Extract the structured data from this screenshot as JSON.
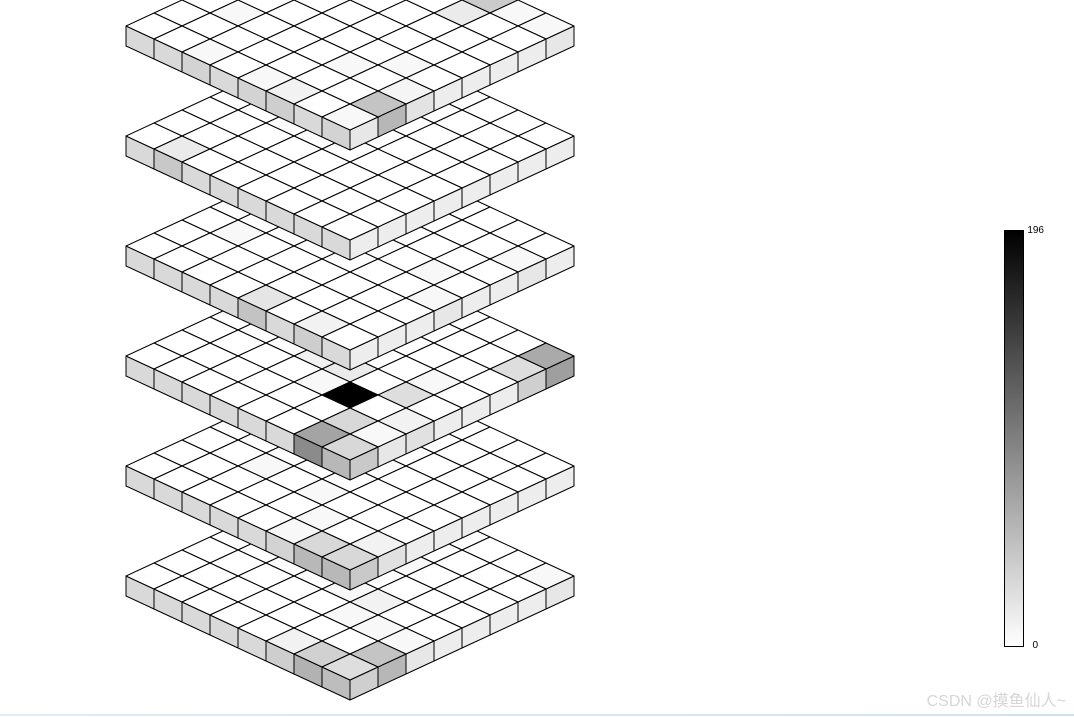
{
  "chart_data": {
    "type": "heatmap",
    "title": "",
    "xlabel": "",
    "ylabel": "",
    "description": "3D voxel grid, 6 stacked layers of 8x8 cubes, grayscale colormap",
    "grid": {
      "nx": 8,
      "ny": 8,
      "nz": 6
    },
    "colormap": {
      "name": "gray_r",
      "min": 0,
      "max": 196
    },
    "layers": [
      {
        "z": 5,
        "values": [
          [
            5,
            45,
            8,
            0,
            0,
            0,
            0,
            5
          ],
          [
            0,
            0,
            0,
            5,
            0,
            0,
            0,
            5
          ],
          [
            10,
            0,
            5,
            0,
            0,
            0,
            15,
            40
          ],
          [
            5,
            0,
            0,
            0,
            0,
            0,
            0,
            0
          ],
          [
            0,
            0,
            0,
            0,
            0,
            0,
            0,
            0
          ],
          [
            5,
            0,
            0,
            0,
            0,
            0,
            0,
            0
          ],
          [
            0,
            0,
            5,
            0,
            0,
            0,
            0,
            0
          ],
          [
            0,
            0,
            0,
            0,
            0,
            0,
            0,
            0
          ]
        ]
      },
      {
        "z": 4,
        "values": [
          [
            0,
            0,
            0,
            0,
            0,
            0,
            0,
            0
          ],
          [
            0,
            0,
            0,
            0,
            0,
            0,
            0,
            0
          ],
          [
            0,
            0,
            0,
            0,
            0,
            0,
            0,
            0
          ],
          [
            0,
            0,
            0,
            0,
            0,
            0,
            0,
            0
          ],
          [
            0,
            0,
            0,
            0,
            0,
            5,
            0,
            0
          ],
          [
            0,
            0,
            0,
            0,
            0,
            0,
            0,
            0
          ],
          [
            15,
            0,
            0,
            0,
            0,
            0,
            0,
            0
          ],
          [
            0,
            0,
            0,
            0,
            0,
            0,
            0,
            0
          ]
        ]
      },
      {
        "z": 3,
        "values": [
          [
            0,
            0,
            0,
            5,
            0,
            0,
            5,
            0
          ],
          [
            10,
            0,
            0,
            0,
            5,
            0,
            0,
            0
          ],
          [
            0,
            0,
            0,
            0,
            0,
            0,
            0,
            0
          ],
          [
            20,
            0,
            0,
            0,
            0,
            0,
            0,
            0
          ],
          [
            0,
            0,
            0,
            0,
            0,
            0,
            0,
            0
          ],
          [
            0,
            0,
            0,
            0,
            0,
            0,
            0,
            0
          ],
          [
            0,
            0,
            5,
            0,
            0,
            0,
            0,
            0
          ],
          [
            0,
            0,
            0,
            0,
            0,
            0,
            0,
            0
          ]
        ]
      },
      {
        "z": 2,
        "values": [
          [
            30,
            5,
            10,
            0,
            0,
            0,
            25,
            65
          ],
          [
            70,
            30,
            0,
            25,
            5,
            0,
            0,
            0
          ],
          [
            0,
            0,
            196,
            0,
            0,
            0,
            0,
            0
          ],
          [
            0,
            0,
            5,
            15,
            0,
            0,
            0,
            0
          ],
          [
            0,
            0,
            0,
            10,
            25,
            5,
            0,
            0
          ],
          [
            0,
            0,
            0,
            0,
            0,
            0,
            0,
            0
          ],
          [
            0,
            0,
            0,
            0,
            10,
            0,
            0,
            0
          ],
          [
            0,
            0,
            0,
            0,
            0,
            0,
            0,
            0
          ]
        ]
      },
      {
        "z": 1,
        "values": [
          [
            30,
            10,
            0,
            0,
            0,
            0,
            0,
            0
          ],
          [
            30,
            0,
            0,
            0,
            0,
            0,
            0,
            0
          ],
          [
            5,
            5,
            0,
            0,
            0,
            0,
            0,
            0
          ],
          [
            0,
            0,
            5,
            0,
            0,
            0,
            0,
            0
          ],
          [
            0,
            0,
            0,
            0,
            0,
            0,
            0,
            0
          ],
          [
            0,
            0,
            5,
            0,
            0,
            0,
            0,
            0
          ],
          [
            0,
            0,
            0,
            0,
            0,
            0,
            0,
            0
          ],
          [
            0,
            0,
            0,
            0,
            0,
            0,
            0,
            0
          ]
        ]
      },
      {
        "z": 0,
        "values": [
          [
            25,
            45,
            5,
            0,
            0,
            0,
            0,
            5
          ],
          [
            35,
            0,
            5,
            0,
            0,
            0,
            0,
            0
          ],
          [
            10,
            0,
            5,
            10,
            0,
            0,
            0,
            0
          ],
          [
            0,
            0,
            0,
            5,
            0,
            5,
            0,
            0
          ],
          [
            0,
            0,
            0,
            0,
            0,
            0,
            0,
            0
          ],
          [
            0,
            0,
            0,
            0,
            10,
            0,
            0,
            0
          ],
          [
            0,
            0,
            0,
            0,
            0,
            0,
            0,
            0
          ],
          [
            0,
            0,
            0,
            0,
            0,
            0,
            0,
            0
          ]
        ]
      }
    ]
  },
  "colorbar": {
    "max_label": "196",
    "min_label": "0"
  },
  "watermark": "CSDN @摸鱼仙人~"
}
